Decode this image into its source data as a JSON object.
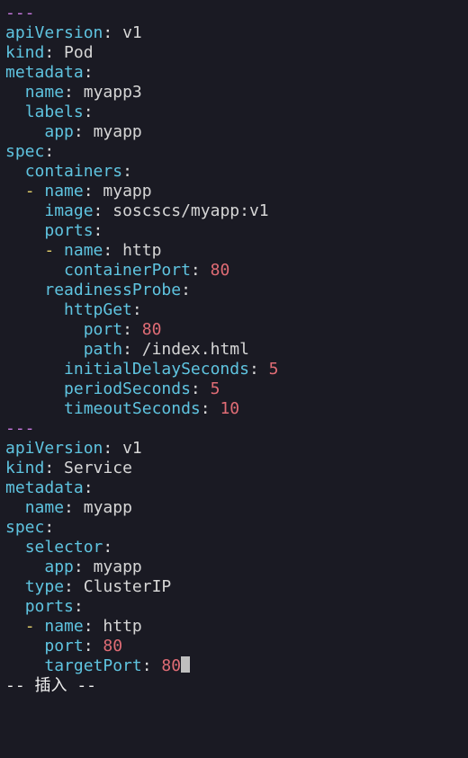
{
  "doc1": {
    "sep": "---",
    "apiVersion_key": "apiVersion",
    "apiVersion_val": "v1",
    "kind_key": "kind",
    "kind_val": "Pod",
    "metadata_key": "metadata",
    "name_key": "name",
    "name_val": "myapp3",
    "labels_key": "labels",
    "app_key": "app",
    "app_val": "myapp",
    "spec_key": "spec",
    "containers_key": "containers",
    "c_name_key": "name",
    "c_name_val": "myapp",
    "image_key": "image",
    "image_val": "soscscs/myapp:v1",
    "ports_key": "ports",
    "p_name_key": "name",
    "p_name_val": "http",
    "containerPort_key": "containerPort",
    "containerPort_val": "80",
    "readinessProbe_key": "readinessProbe",
    "httpGet_key": "httpGet",
    "hp_port_key": "port",
    "hp_port_val": "80",
    "hp_path_key": "path",
    "hp_path_val": "/index.html",
    "ids_key": "initialDelaySeconds",
    "ids_val": "5",
    "ps_key": "periodSeconds",
    "ps_val": "5",
    "ts_key": "timeoutSeconds",
    "ts_val": "10"
  },
  "doc2": {
    "sep": "---",
    "apiVersion_key": "apiVersion",
    "apiVersion_val": "v1",
    "kind_key": "kind",
    "kind_val": "Service",
    "metadata_key": "metadata",
    "name_key": "name",
    "name_val": "myapp",
    "spec_key": "spec",
    "selector_key": "selector",
    "app_key": "app",
    "app_val": "myapp",
    "type_key": "type",
    "type_val": "ClusterIP",
    "ports_key": "ports",
    "p_name_key": "name",
    "p_name_val": "http",
    "port_key": "port",
    "port_val": "80",
    "targetPort_key": "targetPort",
    "targetPort_val": "80"
  },
  "status_line": "-- 插入 --",
  "chart_data": {
    "type": "table",
    "note": "YAML source shown in a terminal vim editor (insert mode)",
    "documents": [
      {
        "apiVersion": "v1",
        "kind": "Pod",
        "metadata": {
          "name": "myapp3",
          "labels": {
            "app": "myapp"
          }
        },
        "spec": {
          "containers": [
            {
              "name": "myapp",
              "image": "soscscs/myapp:v1",
              "ports": [
                {
                  "name": "http",
                  "containerPort": 80
                }
              ],
              "readinessProbe": {
                "httpGet": {
                  "port": 80,
                  "path": "/index.html"
                },
                "initialDelaySeconds": 5,
                "periodSeconds": 5,
                "timeoutSeconds": 10
              }
            }
          ]
        }
      },
      {
        "apiVersion": "v1",
        "kind": "Service",
        "metadata": {
          "name": "myapp"
        },
        "spec": {
          "selector": {
            "app": "myapp"
          },
          "type": "ClusterIP",
          "ports": [
            {
              "name": "http",
              "port": 80,
              "targetPort": 80
            }
          ]
        }
      }
    ]
  }
}
